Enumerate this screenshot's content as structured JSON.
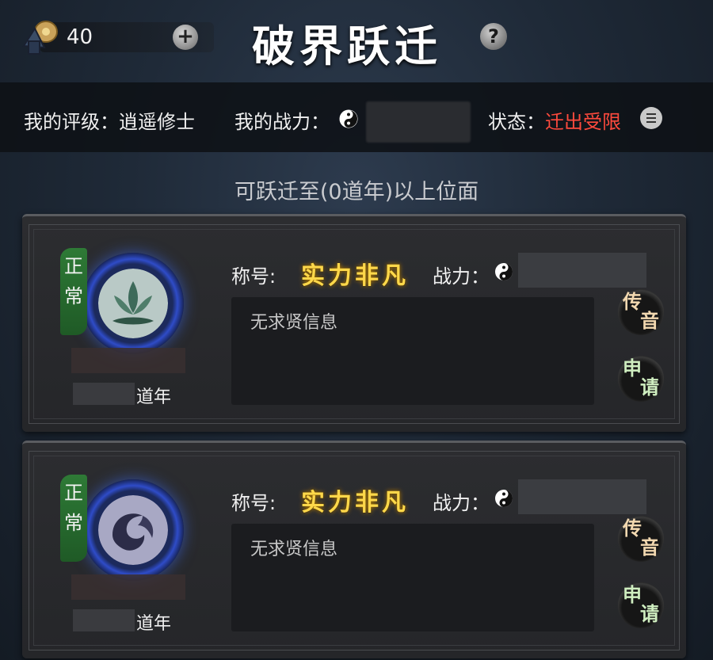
{
  "header": {
    "currency_amount": "40",
    "add_label": "+",
    "title": "破界跃迁",
    "help_label": "?"
  },
  "info": {
    "rating_text": "我的评级：逍遥修士",
    "power_label": "我的战力：",
    "status_label": "状态：",
    "status_value": "迁出受限"
  },
  "subheading": "可跃迁至(0道年)以上位面",
  "cards": [
    {
      "badge": "正常",
      "title_label": "称号:",
      "title_value": "实力非凡",
      "power_label": "战力：",
      "message": "无求贤信息",
      "year_label": "道年",
      "send_label": [
        "传",
        "音"
      ],
      "apply_label": [
        "申",
        "请"
      ],
      "emblem": "lotus-icon"
    },
    {
      "badge": "正常",
      "title_label": "称号:",
      "title_value": "实力非凡",
      "power_label": "战力：",
      "message": "无求贤信息",
      "year_label": "道年",
      "send_label": [
        "传",
        "音"
      ],
      "apply_label": [
        "申",
        "请"
      ],
      "emblem": "phoenix-icon"
    }
  ],
  "colors": {
    "status_red": "#ff4a3d",
    "title_gold": "#ffd84a",
    "badge_green": "#2e7a36",
    "emblem_blue": "#2f4cc8"
  }
}
